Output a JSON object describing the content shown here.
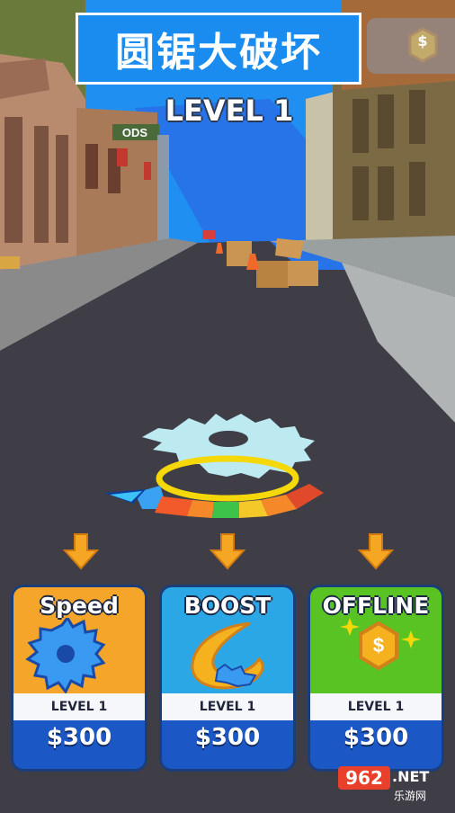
{
  "title": "圆锯大破坏",
  "level_label": "LEVEL 1",
  "coin_symbol": "$",
  "store_sign": "ODS",
  "upgrades": [
    {
      "name": "Speed",
      "level": "LEVEL 1",
      "price": "$300",
      "bg": "#f4a52a",
      "icon": "saw-blade-icon"
    },
    {
      "name": "BOOST",
      "level": "LEVEL 1",
      "price": "$300",
      "bg": "#2ba7e6",
      "icon": "boost-swirl-icon"
    },
    {
      "name": "OFFLINE",
      "level": "LEVEL 1",
      "price": "$300",
      "bg": "#58c322",
      "icon": "coin-icon"
    }
  ],
  "watermark": {
    "brand": "962",
    "suffix": ".NET",
    "sub": "乐游网"
  }
}
